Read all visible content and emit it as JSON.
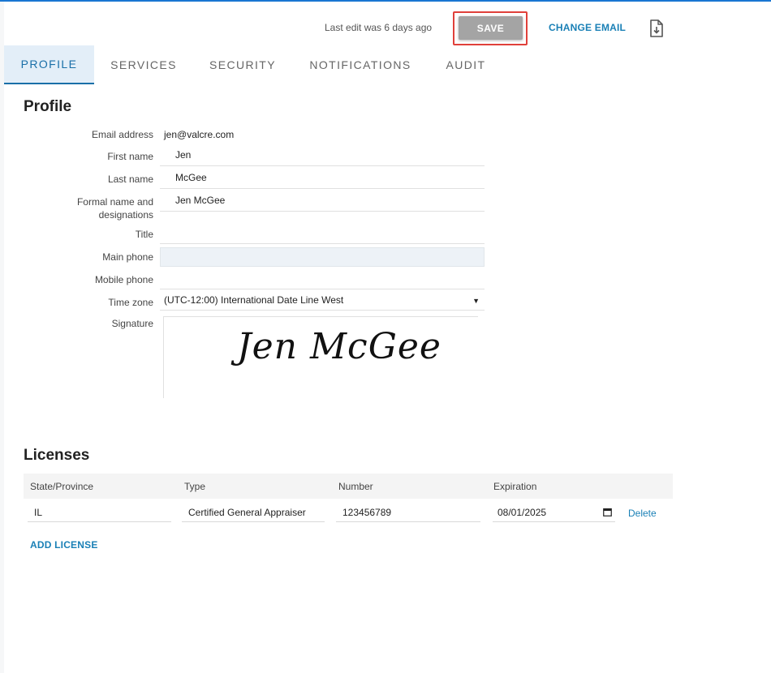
{
  "header": {
    "last_edit": "Last edit was 6 days ago",
    "save_label": "SAVE",
    "change_email_label": "CHANGE EMAIL",
    "download_icon": "file-download-icon"
  },
  "tabs": [
    {
      "label": "PROFILE",
      "active": true
    },
    {
      "label": "SERVICES",
      "active": false
    },
    {
      "label": "SECURITY",
      "active": false
    },
    {
      "label": "NOTIFICATIONS",
      "active": false
    },
    {
      "label": "AUDIT",
      "active": false
    }
  ],
  "profile": {
    "title": "Profile",
    "fields": {
      "email": {
        "label": "Email address",
        "value": "jen@valcre.com"
      },
      "first_name": {
        "label": "First name",
        "value": "Jen"
      },
      "last_name": {
        "label": "Last name",
        "value": "McGee"
      },
      "formal_name": {
        "label": "Formal name and designations",
        "value": "Jen McGee"
      },
      "title": {
        "label": "Title",
        "value": ""
      },
      "main_phone": {
        "label": "Main phone",
        "value": ""
      },
      "mobile_phone": {
        "label": "Mobile phone",
        "value": ""
      },
      "time_zone": {
        "label": "Time zone",
        "value": "(UTC-12:00) International Date Line West"
      },
      "signature": {
        "label": "Signature",
        "value": "Jen McGee"
      }
    }
  },
  "licenses": {
    "title": "Licenses",
    "columns": [
      "State/Province",
      "Type",
      "Number",
      "Expiration"
    ],
    "rows": [
      {
        "state": "IL",
        "type": "Certified General Appraiser",
        "number": "123456789",
        "expiration": "08/01/2025",
        "delete_label": "Delete"
      }
    ],
    "add_label": "ADD LICENSE"
  },
  "colors": {
    "accent": "#1a80b6",
    "save_disabled": "#a4a4a4",
    "highlight": "#e0403a",
    "active_tab_bg": "#e3eef8"
  }
}
